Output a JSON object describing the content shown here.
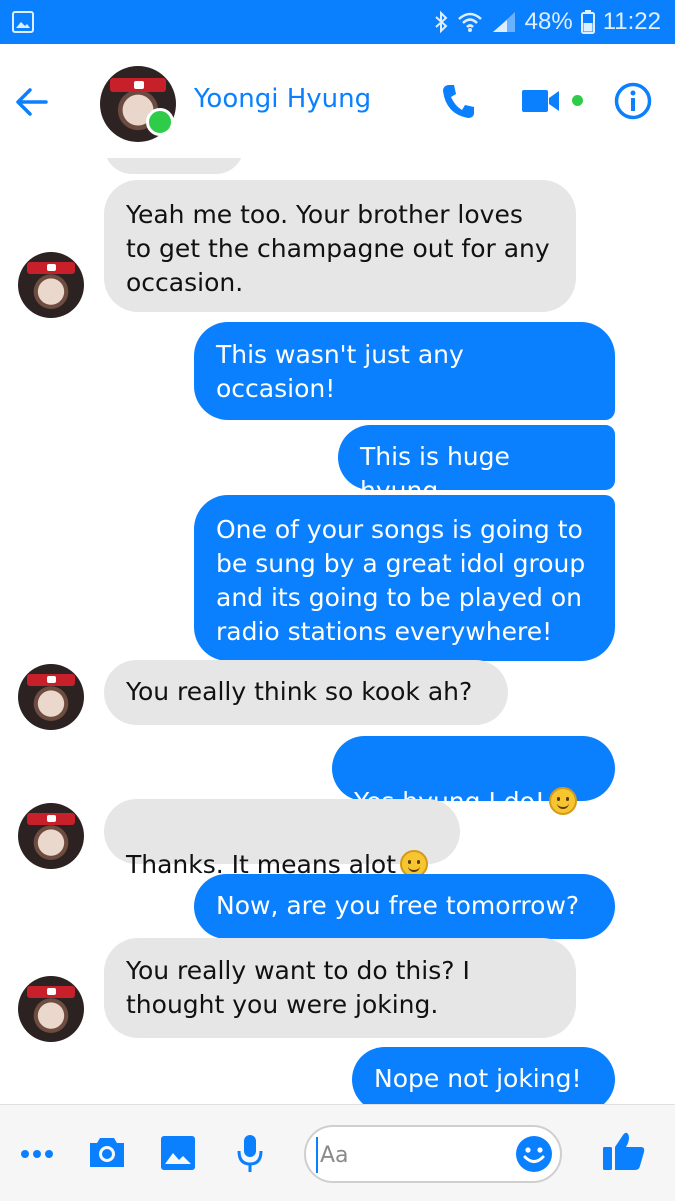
{
  "status_bar": {
    "battery_percent": "48%",
    "time": "11:22"
  },
  "header": {
    "contact_name": "Yoongi Hyung",
    "contact_online": true
  },
  "messages": [
    {
      "direction": "in",
      "text": "Yeah me too. Your brother loves\nto get the champagne out for any\noccasion."
    },
    {
      "direction": "out",
      "text": "This wasn't just any\noccasion!"
    },
    {
      "direction": "out",
      "text": "This is huge hyung"
    },
    {
      "direction": "out",
      "text": "One of your songs is going to\nbe sung by a great idol group\nand its going to be played on\nradio stations everywhere!"
    },
    {
      "direction": "in",
      "text": "You really think so kook ah?"
    },
    {
      "direction": "out",
      "text": "Yes hyung I do!",
      "emoji": "smiling-blush-emoji"
    },
    {
      "direction": "in",
      "text": "Thanks. It means alot",
      "emoji": "slight-smile-emoji"
    },
    {
      "direction": "out",
      "text": "Now, are you free tomorrow?"
    },
    {
      "direction": "in",
      "text": "You really want to do this? I\nthought you were joking."
    },
    {
      "direction": "out",
      "text": "Nope not joking!"
    }
  ],
  "composer": {
    "placeholder": "Aa"
  },
  "colors": {
    "accent": "#0a80ff",
    "incoming_bubble": "#e6e6e6",
    "online": "#2fcc4a"
  }
}
